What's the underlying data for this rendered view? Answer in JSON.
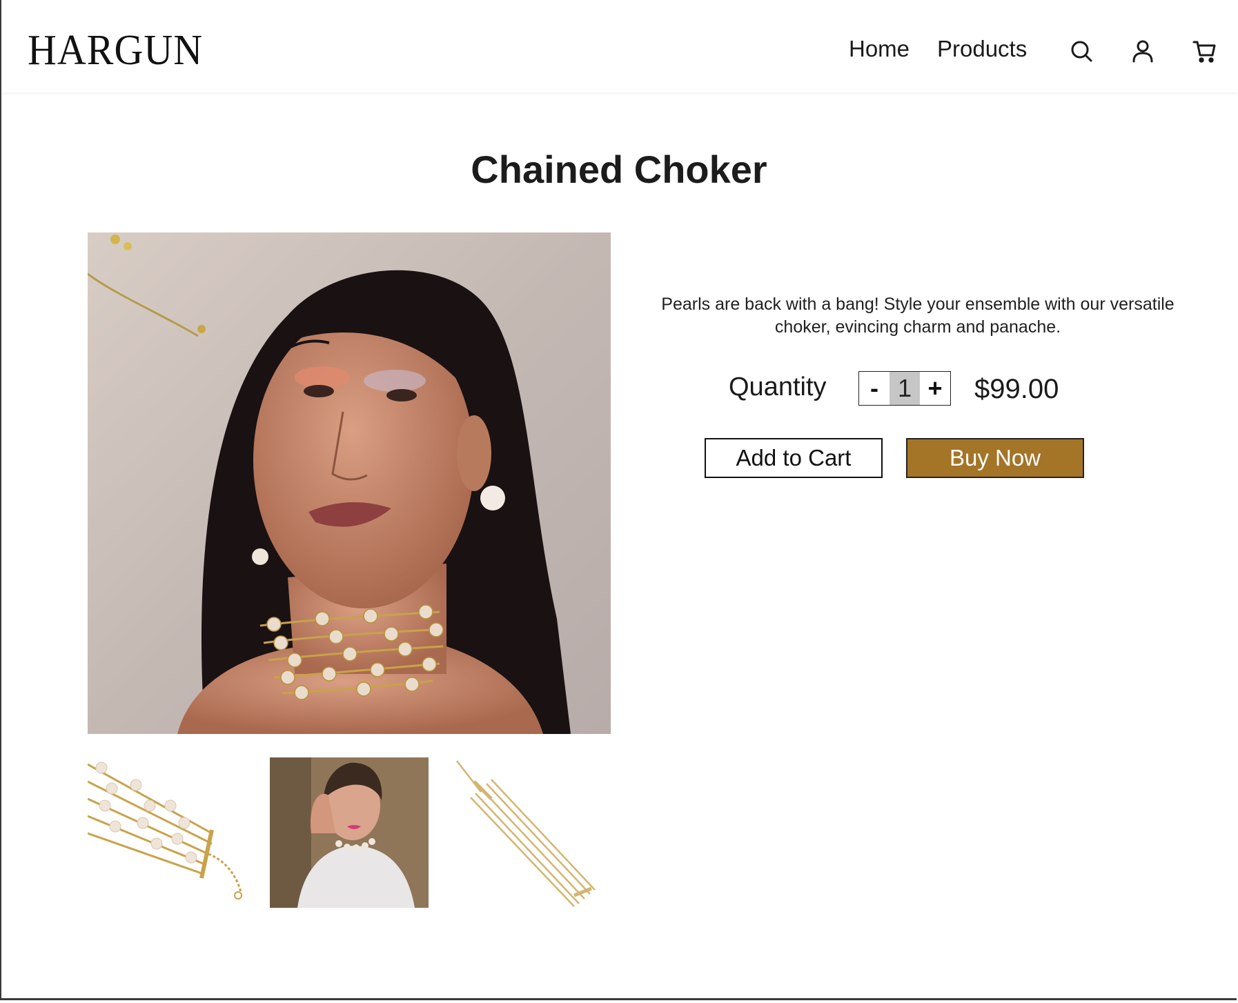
{
  "header": {
    "logo": "HARGUN",
    "nav": [
      {
        "label": "Home"
      },
      {
        "label": "Products"
      }
    ],
    "icons": [
      "search-icon",
      "account-icon",
      "cart-icon"
    ]
  },
  "product": {
    "title": "Chained Choker",
    "description": "Pearls are back with a bang! Style your ensemble with our versatile choker, evincing charm and panache.",
    "quantity_label": "Quantity",
    "quantity_decrement": "-",
    "quantity_value": "1",
    "quantity_increment": "+",
    "price": "$99.00",
    "add_to_cart_label": "Add to Cart",
    "buy_now_label": "Buy Now"
  },
  "colors": {
    "accent": "#a47427",
    "text": "#1a1a1a",
    "stepper_value_bg": "#c6c6c6"
  }
}
